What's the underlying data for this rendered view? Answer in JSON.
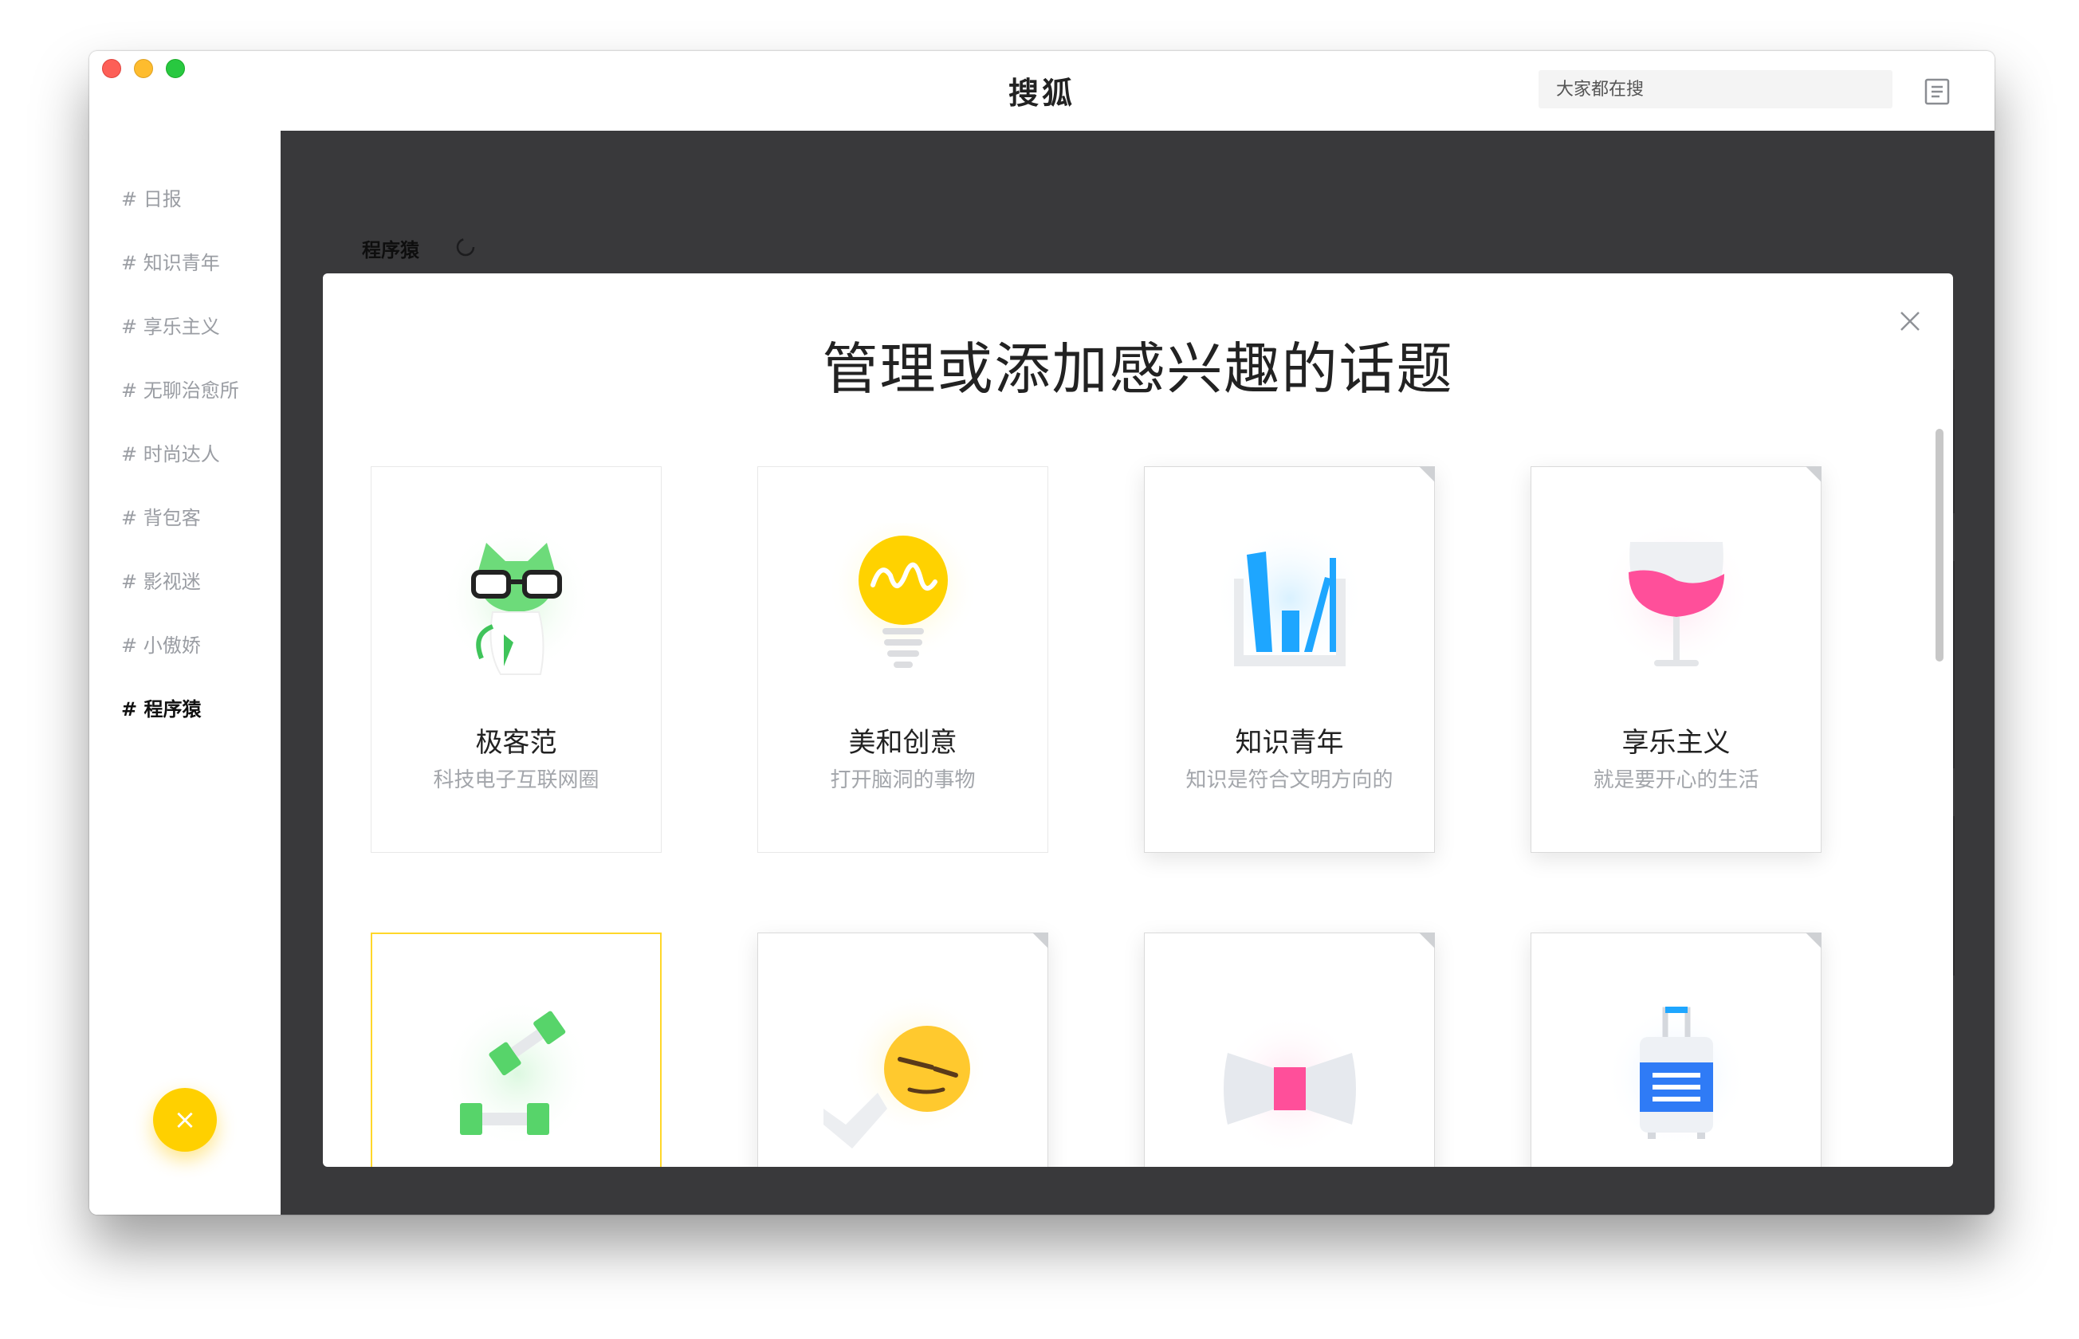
{
  "window": {
    "title": "搜狐"
  },
  "search": {
    "placeholder": "大家都在搜"
  },
  "sidebar": {
    "items": [
      {
        "label": "# 日报"
      },
      {
        "label": "# 知识青年"
      },
      {
        "label": "# 享乐主义"
      },
      {
        "label": "# 无聊治愈所"
      },
      {
        "label": "# 时尚达人"
      },
      {
        "label": "# 背包客"
      },
      {
        "label": "# 影视迷"
      },
      {
        "label": "# 小傲娇"
      },
      {
        "label": "# 程序猿",
        "active": true
      }
    ],
    "fab_label": "×"
  },
  "main": {
    "heading": "程序猿"
  },
  "modal": {
    "title": "管理或添加感兴趣的话题",
    "close_label": "close",
    "topics": [
      {
        "name": "极客范",
        "desc": "科技电子互联网圈",
        "icon": "cat-with-glasses-icon"
      },
      {
        "name": "美和创意",
        "desc": "打开脑洞的事物",
        "icon": "lightbulb-icon"
      },
      {
        "name": "知识青年",
        "desc": "知识是符合文明方向的",
        "icon": "bookshelf-icon"
      },
      {
        "name": "享乐主义",
        "desc": "就是要开心的生活",
        "icon": "wine-glass-icon"
      },
      {
        "name": "",
        "desc": "",
        "icon": "dumbbell-icon"
      },
      {
        "name": "",
        "desc": "",
        "icon": "smug-face-icon"
      },
      {
        "name": "",
        "desc": "",
        "icon": "bow-tie-icon"
      },
      {
        "name": "",
        "desc": "",
        "icon": "suitcase-icon"
      }
    ]
  },
  "colors": {
    "accent": "#ffd000",
    "overlay": "#39393b",
    "green": "#57d46a",
    "pink": "#ff4f9a",
    "blue": "#1ea6ff"
  }
}
